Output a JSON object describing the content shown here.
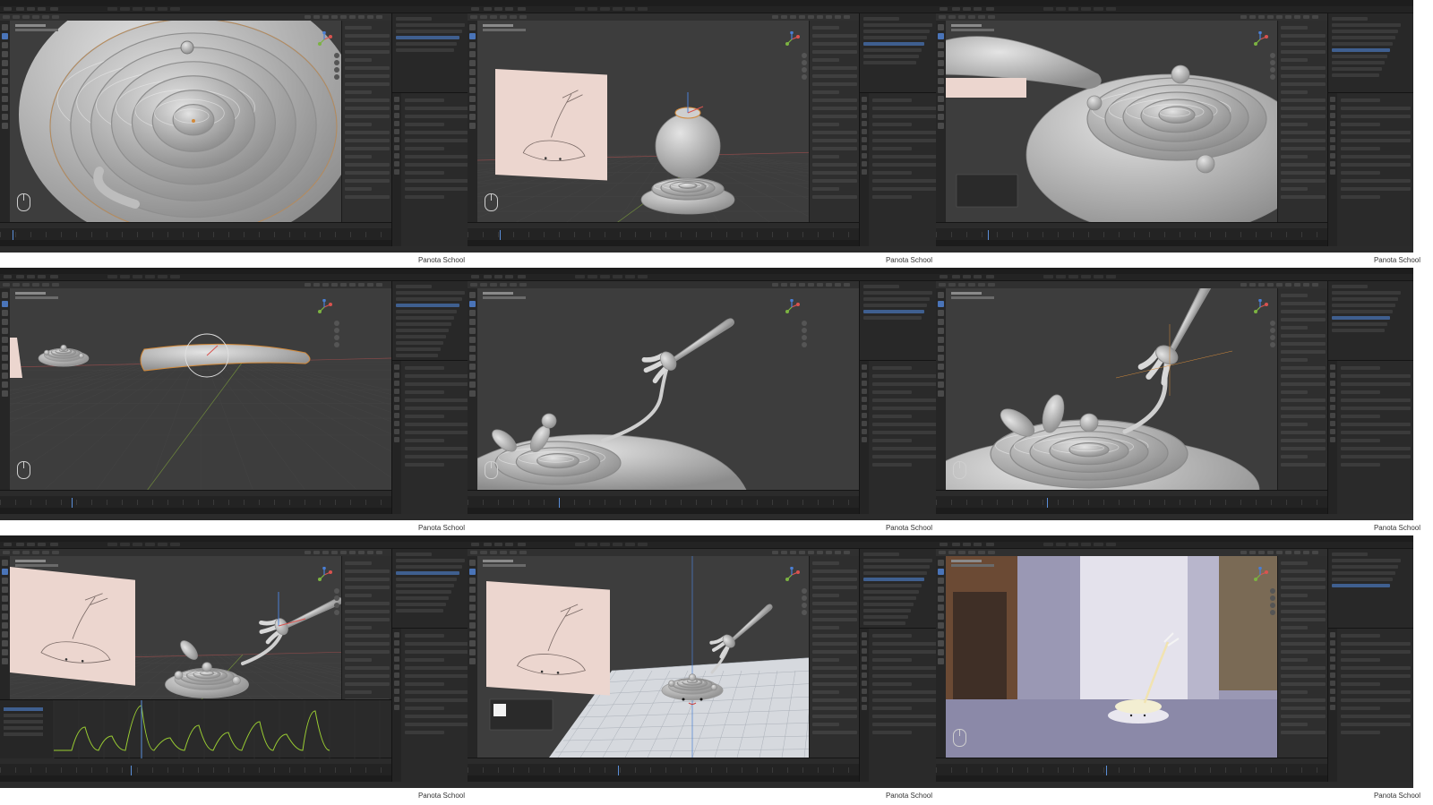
{
  "watermark": "Panota School",
  "app": {
    "name": "Blender",
    "viewport_label": "User Perspective",
    "accent": "#4a74b8",
    "background": "#3d3d3d"
  },
  "cells": [
    {
      "id": "spiral-closeup"
    },
    {
      "id": "bowl-with-reference"
    },
    {
      "id": "spiral-bowl-wide"
    },
    {
      "id": "fork-handle-modeling"
    },
    {
      "id": "noodle-on-fork"
    },
    {
      "id": "bowl-and-fork-detail"
    },
    {
      "id": "graph-editor-animation"
    },
    {
      "id": "scene-on-floor-plane"
    },
    {
      "id": "render-preview"
    }
  ],
  "icons": {
    "mouse": "mouse-icon",
    "gizmo": "axis-gizmo-icon",
    "tools": "tool-icon"
  }
}
